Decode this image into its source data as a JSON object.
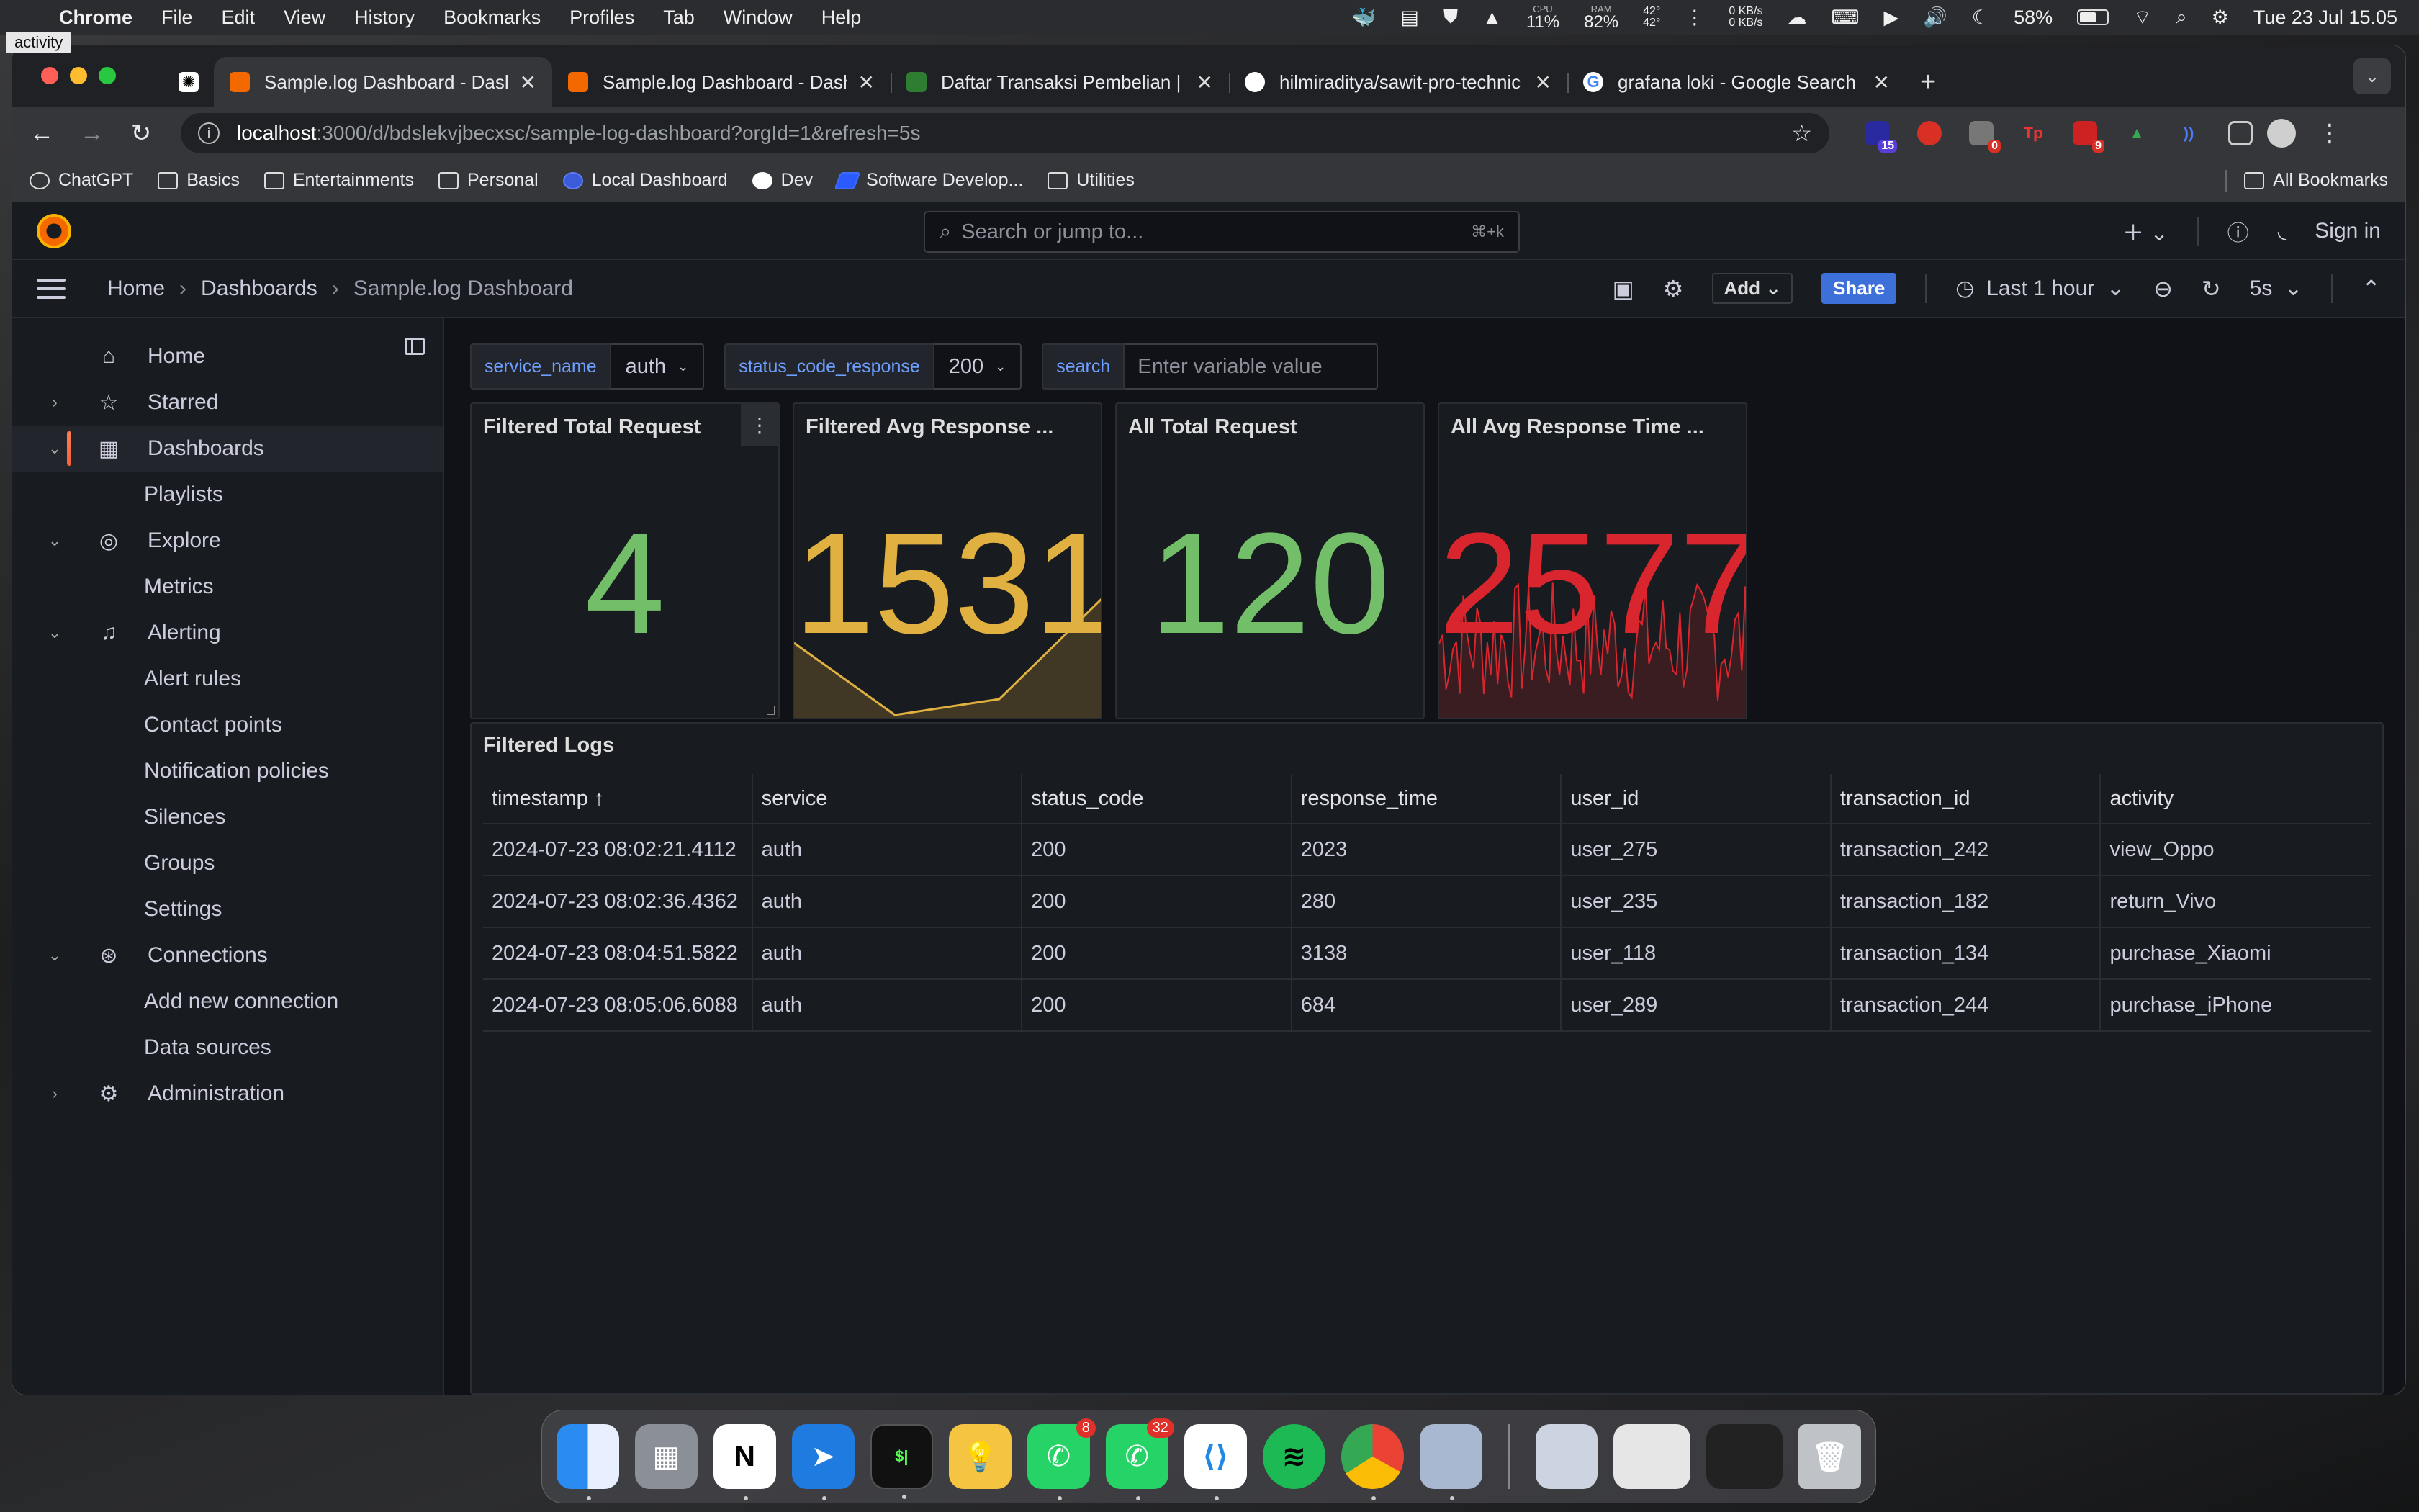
{
  "menubar": {
    "items": [
      "Chrome",
      "File",
      "Edit",
      "View",
      "History",
      "Bookmarks",
      "Profiles",
      "Tab",
      "Window",
      "Help"
    ],
    "cpu_label": "CPU",
    "cpu_value": "11%",
    "ram_label": "RAM",
    "ram_value": "82%",
    "temp_top": "42°",
    "temp_bottom": "42°",
    "net_up": "0 KB/s",
    "net_down": "0 KB/s",
    "battery": "58%",
    "datetime": "Tue 23 Jul  15.05"
  },
  "tooltip": "activity",
  "tabs": [
    {
      "title": "Sample.log Dashboard - Dash",
      "active": true
    },
    {
      "title": "Sample.log Dashboard - Dash",
      "active": false
    },
    {
      "title": "Daftar Transaksi Pembelian | T",
      "active": false
    },
    {
      "title": "hilmiraditya/sawit-pro-technic",
      "active": false
    },
    {
      "title": "grafana loki - Google Search",
      "active": false
    }
  ],
  "address": {
    "host": "localhost",
    "path": ":3000/d/bdslekvjbecxsc/sample-log-dashboard?orgId=1&refresh=5s"
  },
  "extension_badges": {
    "ext1": "15",
    "ext3": "0",
    "ext5": "9"
  },
  "bookmarks": [
    "ChatGPT",
    "Basics",
    "Entertainments",
    "Personal",
    "Local Dashboard",
    "Dev",
    "Software Develop...",
    "Utilities"
  ],
  "bookmarks_all": "All Bookmarks",
  "grafana": {
    "search_placeholder": "Search or jump to...",
    "search_kbd": "⌘+k",
    "sign_in": "Sign in",
    "breadcrumb": [
      "Home",
      "Dashboards",
      "Sample.log Dashboard"
    ],
    "add_label": "Add",
    "share_label": "Share",
    "time_range": "Last 1 hour",
    "refresh_interval": "5s",
    "nav": {
      "home": "Home",
      "starred": "Starred",
      "dashboards": "Dashboards",
      "playlists": "Playlists",
      "explore": "Explore",
      "metrics": "Metrics",
      "alerting": "Alerting",
      "alert_rules": "Alert rules",
      "contact_points": "Contact points",
      "notification_policies": "Notification policies",
      "silences": "Silences",
      "groups": "Groups",
      "settings": "Settings",
      "connections": "Connections",
      "add_connection": "Add new connection",
      "data_sources": "Data sources",
      "administration": "Administration"
    },
    "variables": {
      "service_name_label": "service_name",
      "service_name_value": "auth",
      "status_label": "status_code_response",
      "status_value": "200",
      "search_label": "search",
      "search_placeholder": "Enter variable value"
    },
    "panels": [
      {
        "title": "Filtered Total Request",
        "value": "4",
        "color": "#73bf69"
      },
      {
        "title": "Filtered Avg Response ...",
        "value": "1531",
        "color": "#e0b040"
      },
      {
        "title": "All Total Request",
        "value": "120",
        "color": "#73bf69"
      },
      {
        "title": "All Avg Response Time ...",
        "value": "2577",
        "color": "#d9262e"
      }
    ],
    "logs": {
      "title": "Filtered Logs",
      "columns": [
        "timestamp ↑",
        "service",
        "status_code",
        "response_time",
        "user_id",
        "transaction_id",
        "activity"
      ],
      "rows": [
        [
          "2024-07-23 08:02:21.4112",
          "auth",
          "200",
          "2023",
          "user_275",
          "transaction_242",
          "view_Oppo"
        ],
        [
          "2024-07-23 08:02:36.4362",
          "auth",
          "200",
          "280",
          "user_235",
          "transaction_182",
          "return_Vivo"
        ],
        [
          "2024-07-23 08:04:51.5822",
          "auth",
          "200",
          "3138",
          "user_118",
          "transaction_134",
          "purchase_Xiaomi"
        ],
        [
          "2024-07-23 08:05:06.6088",
          "auth",
          "200",
          "684",
          "user_289",
          "transaction_244",
          "purchase_iPhone"
        ]
      ]
    }
  },
  "dock": {
    "whatsapp_badge": "8",
    "whatsapp2_badge": "32"
  }
}
